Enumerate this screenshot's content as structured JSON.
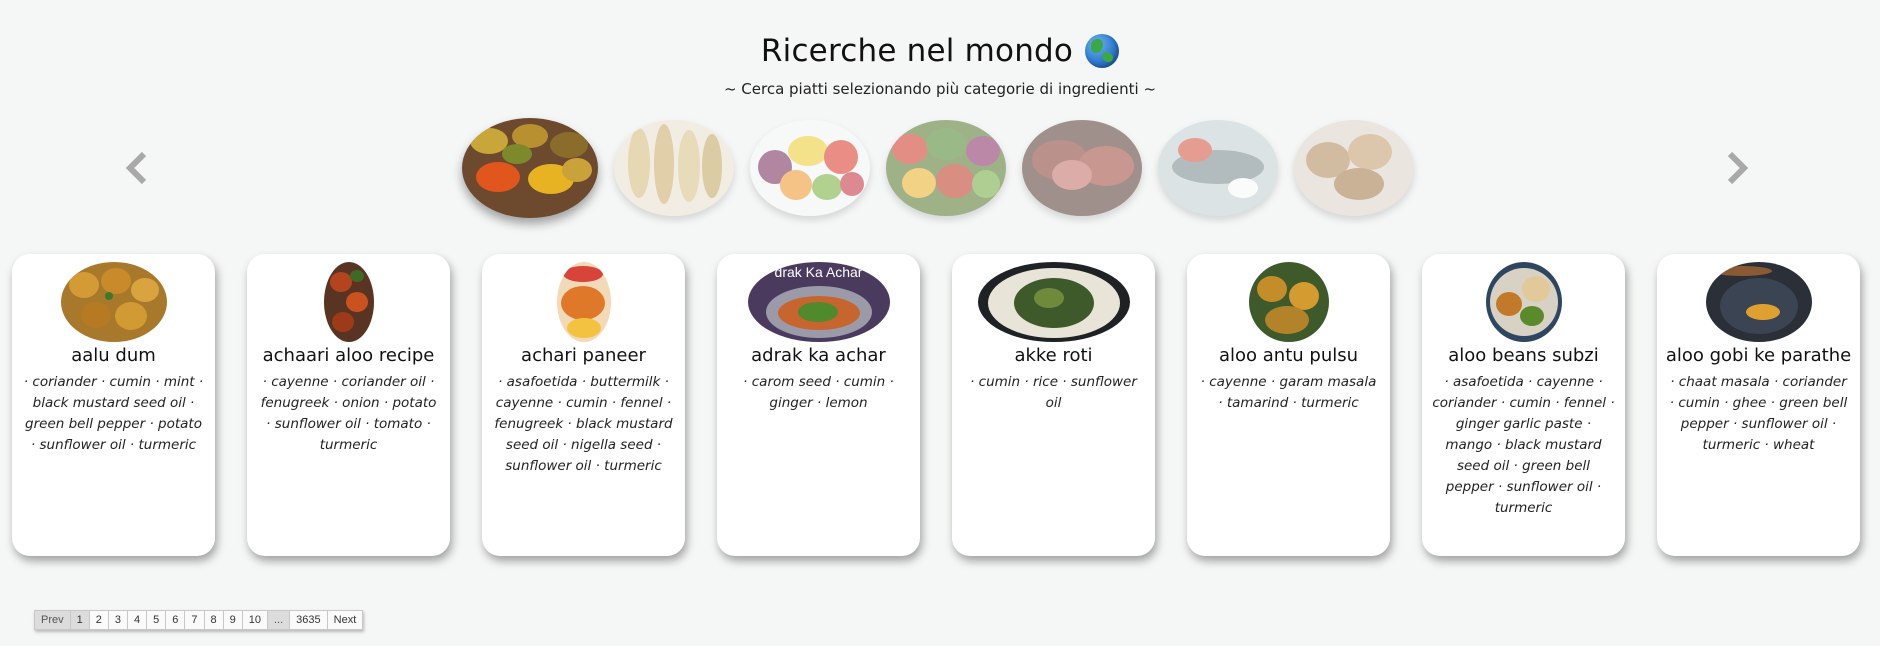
{
  "header": {
    "title": "Ricerche nel mondo",
    "title_icon": "globe-icon",
    "subtitle": "~ Cerca piatti selezionando più categorie di ingredienti ~"
  },
  "carousel": {
    "prev_icon": "chevron-left-icon",
    "next_icon": "chevron-right-icon",
    "categories": [
      {
        "name": "spices",
        "active": true
      },
      {
        "name": "cereals",
        "active": false
      },
      {
        "name": "fruit",
        "active": false
      },
      {
        "name": "vegetables",
        "active": false
      },
      {
        "name": "meat",
        "active": false
      },
      {
        "name": "fish",
        "active": false
      },
      {
        "name": "bread",
        "active": false
      }
    ]
  },
  "recipes": [
    {
      "title": "aalu dum",
      "ingredients": "· coriander · cumin · mint · black mustard seed oil · green bell pepper · potato · sunflower oil · turmeric"
    },
    {
      "title": "achaari aloo recipe",
      "ingredients": "· cayenne · coriander oil · fenugreek · onion · potato · sunflower oil · tomato · turmeric"
    },
    {
      "title": "achari paneer",
      "ingredients": "· asafoetida · buttermilk · cayenne · cumin · fennel · fenugreek · black mustard seed oil · nigella seed · sunflower oil · turmeric"
    },
    {
      "title": "adrak ka achar",
      "thumb_text": "drak Ka Achar",
      "ingredients": "· carom seed · cumin · ginger · lemon"
    },
    {
      "title": "akke roti",
      "ingredients": "· cumin · rice · sunflower oil"
    },
    {
      "title": "aloo antu pulsu",
      "ingredients": "· cayenne · garam masala · tamarind · turmeric"
    },
    {
      "title": "aloo beans subzi",
      "ingredients": "· asafoetida · cayenne · coriander · cumin · fennel · ginger garlic paste · mango · black mustard seed oil · green bell pepper · sunflower oil · turmeric"
    },
    {
      "title": "aloo gobi ke parathe",
      "ingredients": "· chaat masala · coriander · cumin · ghee · green bell pepper · sunflower oil · turmeric · wheat"
    }
  ],
  "pagination": {
    "prev": "Prev",
    "pages": [
      "1",
      "2",
      "3",
      "4",
      "5",
      "6",
      "7",
      "8",
      "9",
      "10",
      "...",
      "3635"
    ],
    "current": "1",
    "next": "Next"
  },
  "colors": {
    "background": "#f5f7f6",
    "card": "#ffffff",
    "arrow": "#a9a9a9"
  }
}
